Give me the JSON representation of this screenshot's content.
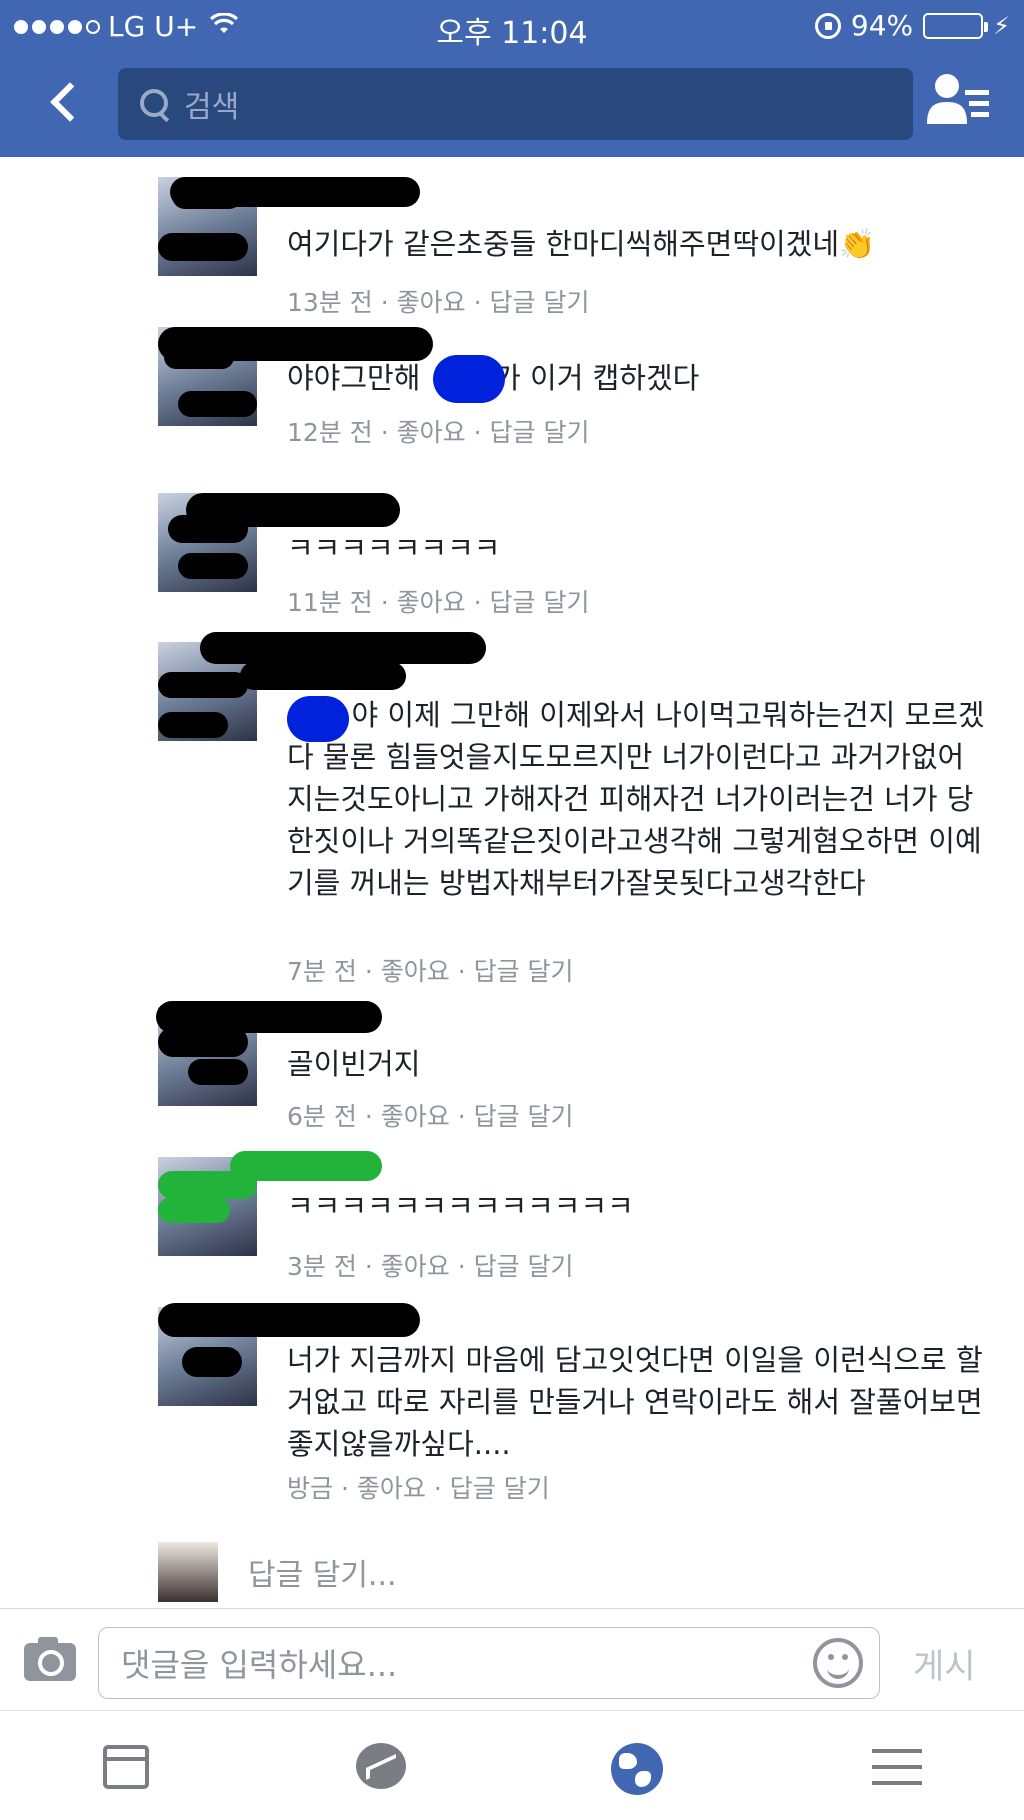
{
  "status_bar": {
    "carrier": "LG U+",
    "time": "오후 11:04",
    "battery": "94%",
    "battery_level": 0.94,
    "signal_bars_filled": 4
  },
  "nav": {
    "search_placeholder": "검색",
    "back_icon": "chevron-left-icon",
    "friends_icon": "friend-list-icon"
  },
  "comments": [
    {
      "text": "여기다가 같은초중들 한마디씩해주면딱이겠네👏",
      "time": "13분 전",
      "like": "좋아요",
      "reply": "답글 달기"
    },
    {
      "text": "야야그만해        가 이거 캡하겠다",
      "time": "12분 전",
      "like": "좋아요",
      "reply": "답글 달기"
    },
    {
      "text": "ㅋㅋㅋㅋㅋㅋㅋㅋ",
      "time": "11분 전",
      "like": "좋아요",
      "reply": "답글 달기"
    },
    {
      "text": "       야 이제 그만해 이제와서 나이먹고뭐하는건지 모르겠다 물론 힘들엇을지도모르지만 너가이런다고 과거가없어지는것도아니고 가해자건 피해자건 너가이러는건 너가 당한짓이나 거의똑같은짓이라고생각해 그렇게혐오하면 이예기를 꺼내는 방법자채부터가잘못됫다고생각한다",
      "time": "7분 전",
      "like": "좋아요",
      "reply": "답글 달기"
    },
    {
      "text": "골이빈거지",
      "time": "6분 전",
      "like": "좋아요",
      "reply": "답글 달기"
    },
    {
      "text": "ㅋㅋㅋㅋㅋㅋㅋㅋㅋㅋㅋㅋㅋ",
      "time": "3분 전",
      "like": "좋아요",
      "reply": "답글 달기"
    },
    {
      "text": "너가 지금까지 마음에 담고잇엇다면 이일을 이런식으로 할거없고 따로 자리를 만들거나 연락이라도 해서 잘풀어보면 좋지않을까싶다....",
      "time": "방금",
      "like": "좋아요",
      "reply": "답글 달기"
    }
  ],
  "meta_separator": "·",
  "reply_prompt": "답글 달기...",
  "composer": {
    "placeholder": "댓글을 입력하세요...",
    "post_label": "게시",
    "camera_icon": "camera-icon",
    "emoji_icon": "smiley-icon"
  },
  "tabbar": {
    "icons": [
      "news-feed-icon",
      "messenger-icon",
      "globe-notifications-icon",
      "menu-icon"
    ],
    "active_index": 2
  },
  "colors": {
    "brand": "#4267b2",
    "search_bg": "#29487d",
    "meta_gray": "#90949c",
    "battery_green": "#4cd964",
    "redaction_blue": "#0022dd",
    "redaction_green": "#21b33a"
  }
}
